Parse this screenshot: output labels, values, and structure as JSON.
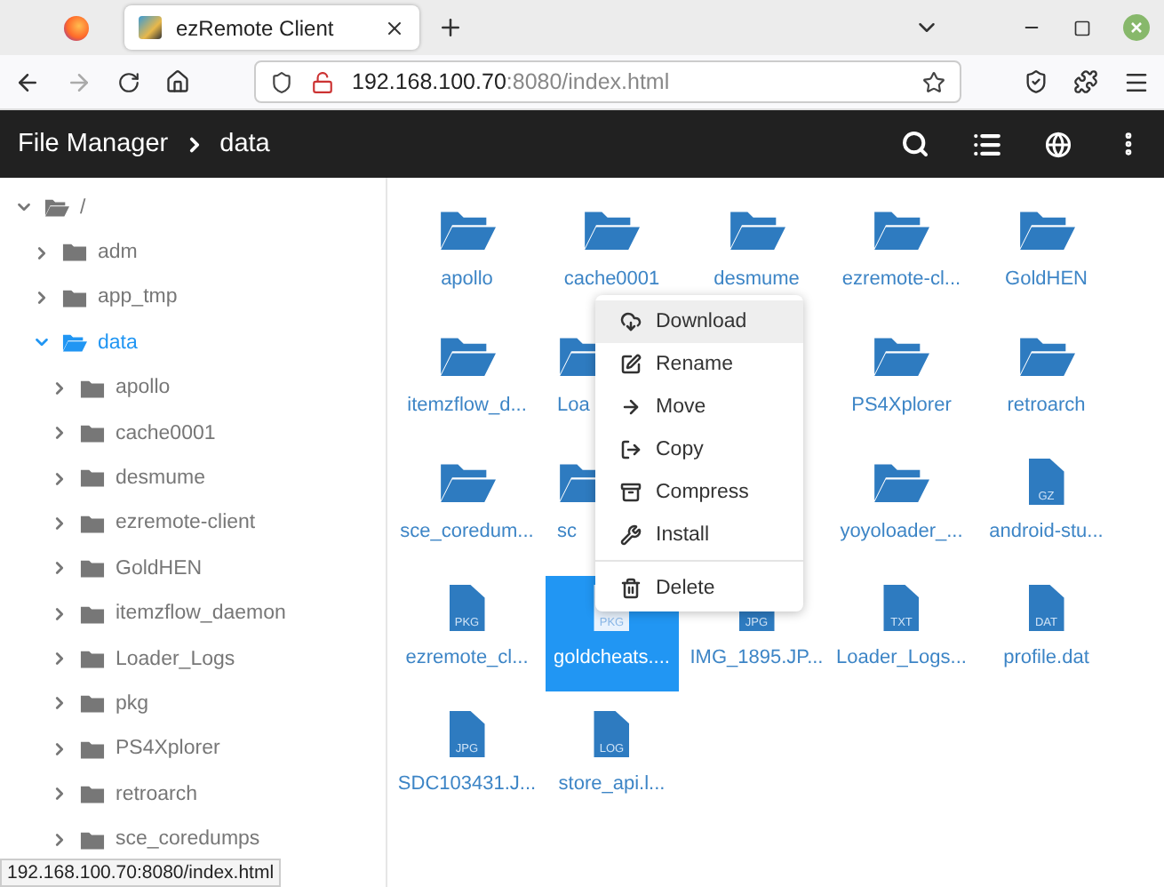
{
  "browser": {
    "tab_title": "ezRemote Client",
    "address_host": "192.168.100.70",
    "address_rest": ":8080/index.html"
  },
  "header": {
    "title": "File Manager",
    "breadcrumb": "data"
  },
  "tree": {
    "label": "/",
    "expanded": true,
    "selected": false,
    "children": [
      {
        "label": "adm",
        "expanded": false,
        "selected": false
      },
      {
        "label": "app_tmp",
        "expanded": false,
        "selected": false
      },
      {
        "label": "data",
        "expanded": true,
        "selected": true,
        "children": [
          {
            "label": "apollo",
            "expanded": false,
            "selected": false
          },
          {
            "label": "cache0001",
            "expanded": false,
            "selected": false
          },
          {
            "label": "desmume",
            "expanded": false,
            "selected": false
          },
          {
            "label": "ezremote-client",
            "expanded": false,
            "selected": false
          },
          {
            "label": "GoldHEN",
            "expanded": false,
            "selected": false
          },
          {
            "label": "itemzflow_daemon",
            "expanded": false,
            "selected": false
          },
          {
            "label": "Loader_Logs",
            "expanded": false,
            "selected": false
          },
          {
            "label": "pkg",
            "expanded": false,
            "selected": false
          },
          {
            "label": "PS4Xplorer",
            "expanded": false,
            "selected": false
          },
          {
            "label": "retroarch",
            "expanded": false,
            "selected": false
          },
          {
            "label": "sce_coredumps",
            "expanded": false,
            "selected": false
          }
        ]
      }
    ]
  },
  "files": [
    {
      "kind": "folder",
      "name": "apollo",
      "selected": false
    },
    {
      "kind": "folder",
      "name": "cache0001",
      "selected": false
    },
    {
      "kind": "folder",
      "name": "desmume",
      "selected": false
    },
    {
      "kind": "folder",
      "name": "ezremote-cl...",
      "selected": false
    },
    {
      "kind": "folder",
      "name": "GoldHEN",
      "selected": false
    },
    {
      "kind": "folder",
      "name": "itemzflow_d...",
      "selected": false
    },
    {
      "kind": "cutfolder",
      "name": "Loa",
      "selected": false
    },
    {
      "kind": "gap"
    },
    {
      "kind": "folder",
      "name": "PS4Xplorer",
      "selected": false
    },
    {
      "kind": "folder",
      "name": "retroarch",
      "selected": false
    },
    {
      "kind": "folder",
      "name": "sce_coredum...",
      "selected": false
    },
    {
      "kind": "cutfolder",
      "name": "sc",
      "selected": false
    },
    {
      "kind": "gap"
    },
    {
      "kind": "folder",
      "name": "yoyoloader_...",
      "selected": false
    },
    {
      "kind": "file",
      "ext": "GZ",
      "name": "android-stu...",
      "selected": false
    },
    {
      "kind": "file",
      "ext": "PKG",
      "name": "ezremote_cl...",
      "selected": false
    },
    {
      "kind": "file",
      "ext": "PKG",
      "name": "goldcheats....",
      "selected": true
    },
    {
      "kind": "file",
      "ext": "JPG",
      "name": "IMG_1895.JP...",
      "selected": false
    },
    {
      "kind": "file",
      "ext": "TXT",
      "name": "Loader_Logs...",
      "selected": false
    },
    {
      "kind": "file",
      "ext": "DAT",
      "name": "profile.dat",
      "selected": false
    },
    {
      "kind": "file",
      "ext": "JPG",
      "name": "SDC103431.J...",
      "selected": false
    },
    {
      "kind": "file",
      "ext": "LOG",
      "name": "store_api.l...",
      "selected": false
    }
  ],
  "context_menu": [
    {
      "kind": "item",
      "label": "Download",
      "highlighted": true
    },
    {
      "kind": "item",
      "label": "Rename",
      "highlighted": false
    },
    {
      "kind": "item",
      "label": "Move",
      "highlighted": false
    },
    {
      "kind": "item",
      "label": "Copy",
      "highlighted": false
    },
    {
      "kind": "item",
      "label": "Compress",
      "highlighted": false
    },
    {
      "kind": "item",
      "label": "Install",
      "highlighted": false
    },
    {
      "kind": "divider"
    },
    {
      "kind": "item",
      "label": "Delete",
      "highlighted": false
    }
  ],
  "status_link": "192.168.100.70:8080/index.html"
}
